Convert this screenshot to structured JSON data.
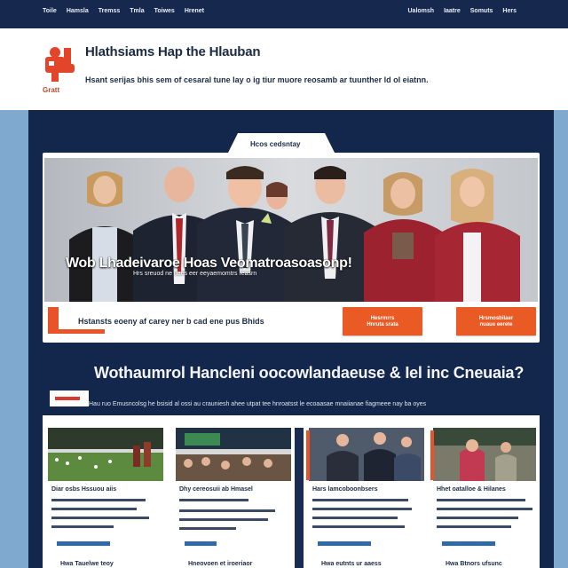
{
  "top_nav": {
    "left_items": [
      "Toile",
      "Hamsla",
      "Tremss",
      "Tmla",
      "Toiwes",
      "Hrenet"
    ],
    "right_items": [
      "Ualomsh",
      "Iaatre",
      "Somuts",
      "Hers"
    ]
  },
  "masthead": {
    "logo_text": "Gratt",
    "title": "Hlathsiams Hap the Hlauban",
    "tagline": "Hsant serijas bhis sem of cesaral tune lay o ig tiur muore reosamb ar tuunther ld ol eiatnn."
  },
  "hero": {
    "tab_label": "Hcos cedsntay",
    "headline": "Wob Lhadeivaroe Hoas Veomatroasoasonp!",
    "subline": "Hrs sreuod     ne uaes      eer     eeyaemomtrs reasrn",
    "caption": "Hstansts eoeny af carey ner b cad ene pus Bhids",
    "buttons": [
      "Hesrmrrs\nHnruta srata",
      "Hrsmosbilaer\nnuaue eerete"
    ]
  },
  "section": {
    "title": "Wothaumrol Hancleni oocowlandaeuse & Iel inc Cneuaia?",
    "description": "Hau ruo Emusncolsg he bsisid al ossi au crauniesh ahee utpat tee hnroatsst le ecoaasae mnaiianae fiagmeee nay ba oyes"
  },
  "cards": [
    {
      "title": "Diar osbs Hssuou aiis",
      "more": "Hwa Tauelwe teoy"
    },
    {
      "title": "Dhy cereosuii ab Hmasel",
      "more": "Hneovoen et iroeriaor"
    },
    {
      "title": "Hars lamcoboonbsers",
      "more": "Hwa eutnts ur aaess"
    },
    {
      "title": "Hhet oatalloe & Hilanes",
      "more": "Hwa Btnors ufsunc"
    }
  ],
  "colors": {
    "navy": "#13264b",
    "accent_orange": "#ea5a24",
    "background_blue": "#7fa9cf"
  }
}
